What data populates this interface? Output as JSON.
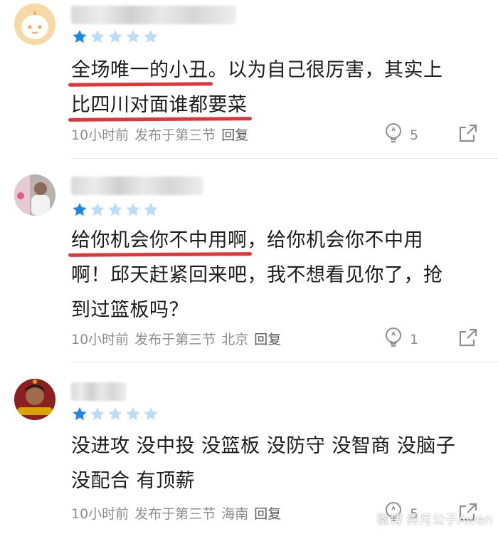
{
  "comments": [
    {
      "rating": 1,
      "text_underlined_1": "全场唯一的小丑",
      "text_rest_1": "。以为自己很厉害，其实上\n",
      "text_underlined_2": "比四川对面谁都要菜",
      "text_rest_2": "",
      "meta": {
        "time": "10小时前",
        "section": "发布于第三节",
        "location": "",
        "reply": "回复"
      },
      "likes": "5"
    },
    {
      "rating": 1,
      "text_underlined_1": "给你机会你不中用啊",
      "text_rest_1": "，给你机会你不中用\n啊！邱天赶紧回来吧，我不想看见你了，抢\n到过篮板吗？",
      "meta": {
        "time": "10小时前",
        "section": "发布于第三节",
        "location": "北京",
        "reply": "回复"
      },
      "likes": "1"
    },
    {
      "rating": 1,
      "text": "没进攻 没中投 没篮板 没防守 没智商 没脑子\n没配合 有顶薪",
      "meta": {
        "time": "10小时前",
        "section": "发布于第三节",
        "location": "海南",
        "reply": "回复"
      },
      "likes": "5"
    }
  ],
  "watermark": "微博 弄月公子Awen",
  "colors": {
    "star_filled": "#1e86e6",
    "star_empty": "#bcdcf8",
    "underline": "#e0363a"
  },
  "icons": [
    "avatar-bot-icon",
    "star-icon",
    "lightbulb-like-icon",
    "share-icon",
    "weibo-icon"
  ]
}
